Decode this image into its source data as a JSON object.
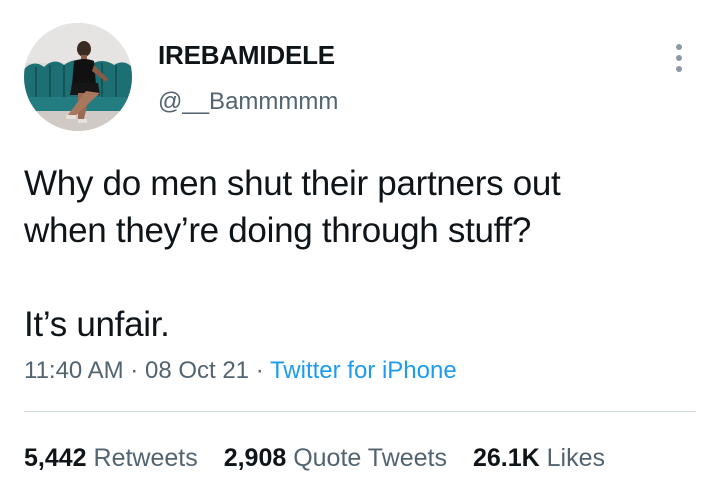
{
  "user": {
    "display_name": "IREBAMIDELE",
    "handle": "@__Bammmmm"
  },
  "tweet": {
    "text": "Why do men shut their partners out\nwhen they’re doing through stuff?\n\nIt’s unfair.",
    "time": "11:40 AM",
    "separator": "·",
    "date": "08 Oct 21",
    "source": "Twitter for iPhone"
  },
  "stats": {
    "retweets_count": "5,442",
    "retweets_label": "Retweets",
    "quotes_count": "2,908",
    "quotes_label": "Quote Tweets",
    "likes_count": "26.1K",
    "likes_label": "Likes"
  },
  "icons": {
    "more": "more-vertical-icon",
    "avatar": "profile-photo"
  },
  "colors": {
    "text": "#0f1419",
    "secondary": "#536471",
    "link": "#1d9bf0",
    "divider": "#cfd9de"
  }
}
